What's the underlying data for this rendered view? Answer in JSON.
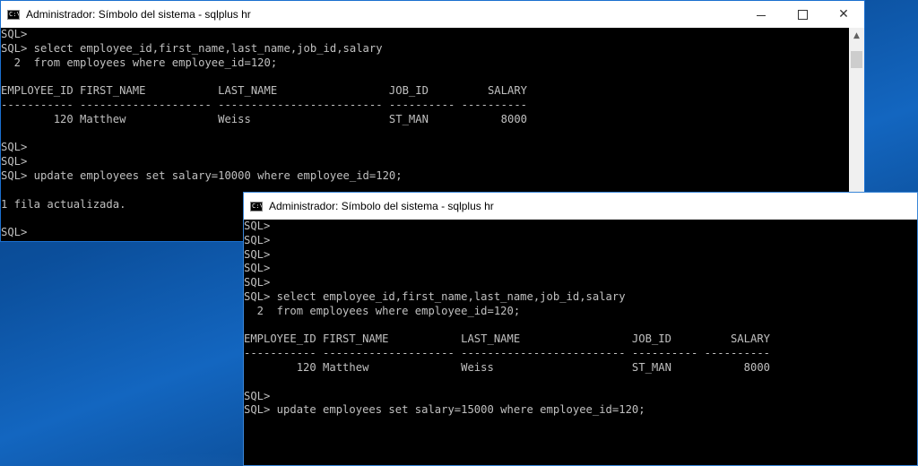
{
  "window_back": {
    "title": "Administrador: Símbolo del sistema - sqlplus  hr",
    "console_lines": [
      "SQL>",
      "SQL> select employee_id,first_name,last_name,job_id,salary",
      "  2  from employees where employee_id=120;",
      "",
      "EMPLOYEE_ID FIRST_NAME           LAST_NAME                 JOB_ID         SALARY",
      "----------- -------------------- ------------------------- ---------- ----------",
      "        120 Matthew              Weiss                     ST_MAN           8000",
      "",
      "SQL>",
      "SQL>",
      "SQL> update employees set salary=10000 where employee_id=120;",
      "",
      "1 fila actualizada.",
      "",
      "SQL>"
    ]
  },
  "window_front": {
    "title": "Administrador: Símbolo del sistema - sqlplus  hr",
    "console_lines": [
      "SQL>",
      "SQL>",
      "SQL>",
      "SQL>",
      "SQL>",
      "SQL> select employee_id,first_name,last_name,job_id,salary",
      "  2  from employees where employee_id=120;",
      "",
      "EMPLOYEE_ID FIRST_NAME           LAST_NAME                 JOB_ID         SALARY",
      "----------- -------------------- ------------------------- ---------- ----------",
      "        120 Matthew              Weiss                     ST_MAN           8000",
      "",
      "SQL>",
      "SQL> update employees set salary=15000 where employee_id=120;"
    ]
  },
  "controls": {
    "minimize_glyph": "",
    "maximize_glyph": "",
    "close_glyph": "✕",
    "scroll_up_glyph": "▲"
  },
  "icons": [
    "console-icon",
    "minimize-icon",
    "maximize-icon",
    "close-icon",
    "scroll-up-arrow-icon"
  ],
  "colors": {
    "console_bg": "#000000",
    "console_text": "#c0c0c0",
    "titlebar_bg": "#ffffff",
    "desktop_blue": "#0b4f9c"
  }
}
